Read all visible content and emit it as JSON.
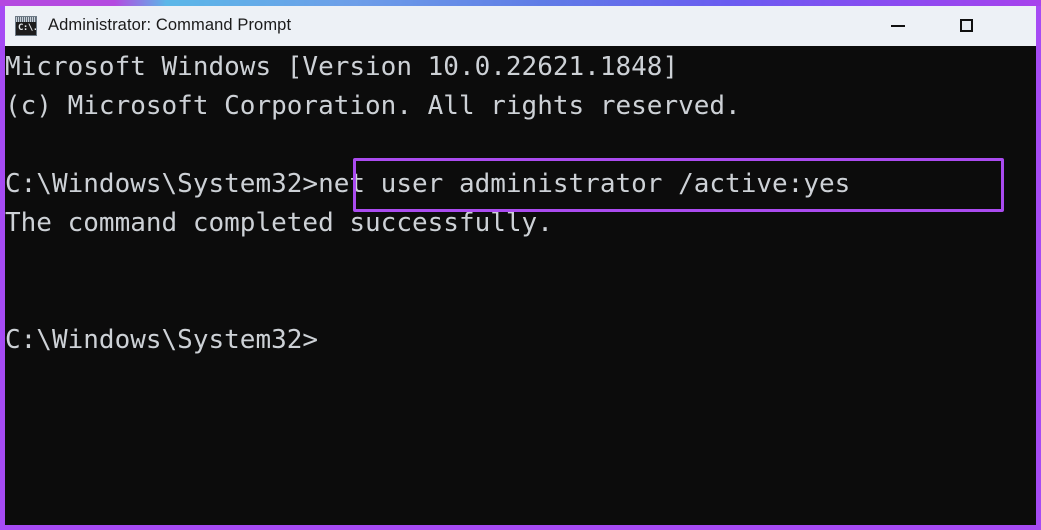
{
  "window": {
    "title": "Administrator: Command Prompt",
    "icon_name": "command-prompt-icon",
    "icon_glyph": "C:\\.",
    "accent_color": "#a64bf4",
    "titlebar_color": "#edf1f6",
    "console_background": "#0c0c0c",
    "console_foreground": "#cdd1d6"
  },
  "controls": {
    "minimize_label": "—",
    "maximize_label": "□",
    "close_label": ""
  },
  "console": {
    "lines": [
      "Microsoft Windows [Version 10.0.22621.1848]",
      "(c) Microsoft Corporation. All rights reserved.",
      "",
      "C:\\Windows\\System32>net user administrator /active:yes",
      "The command completed successfully.",
      "",
      "",
      "C:\\Windows\\System32>"
    ],
    "full_text": "Microsoft Windows [Version 10.0.22621.1848]\n(c) Microsoft Corporation. All rights reserved.\n\nC:\\Windows\\System32>net user administrator /active:yes\nThe command completed successfully.\n\n\nC:\\Windows\\System32>",
    "os_name": "Microsoft Windows",
    "os_version": "10.0.22621.1848",
    "copyright": "(c) Microsoft Corporation. All rights reserved.",
    "prompt_path": "C:\\Windows\\System32>",
    "command": "net user administrator /active:yes",
    "result_message": "The command completed successfully."
  },
  "annotation": {
    "highlight_target": "net user administrator /active:yes",
    "highlight_color": "#aa4bf0"
  }
}
